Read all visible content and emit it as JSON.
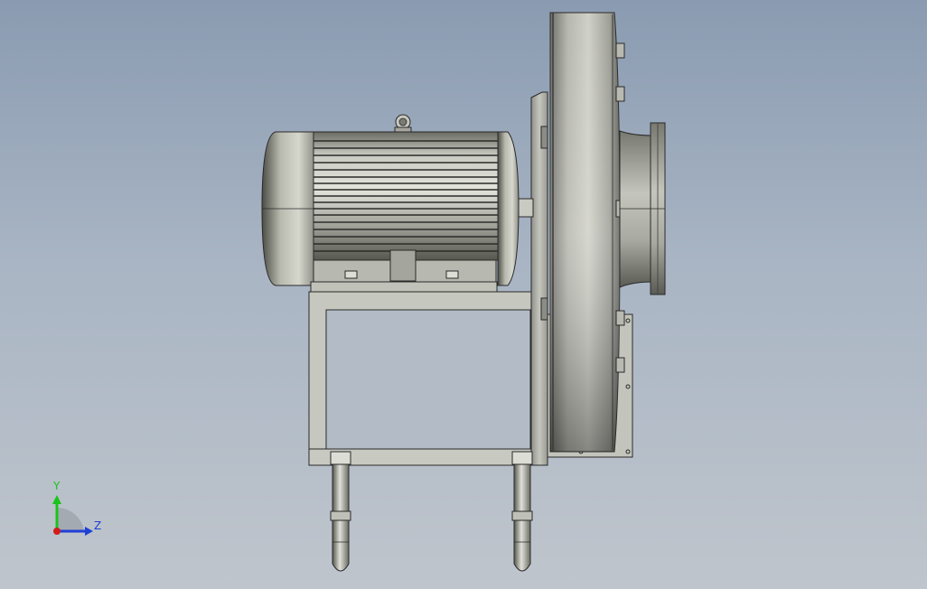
{
  "triad": {
    "y_label": "Y",
    "z_label": "Z",
    "colors": {
      "y_axis": "#19c419",
      "z_axis": "#1f3fd6",
      "x_axis": "#d11c1c"
    }
  },
  "colors": {
    "background_top": "#8a9bb1",
    "background_bottom": "#bfc5cc",
    "metal_dark": "#55564e",
    "metal_light": "#d2d3c9",
    "frame": "#c8c8c0",
    "edge": "#2a2a2a"
  }
}
